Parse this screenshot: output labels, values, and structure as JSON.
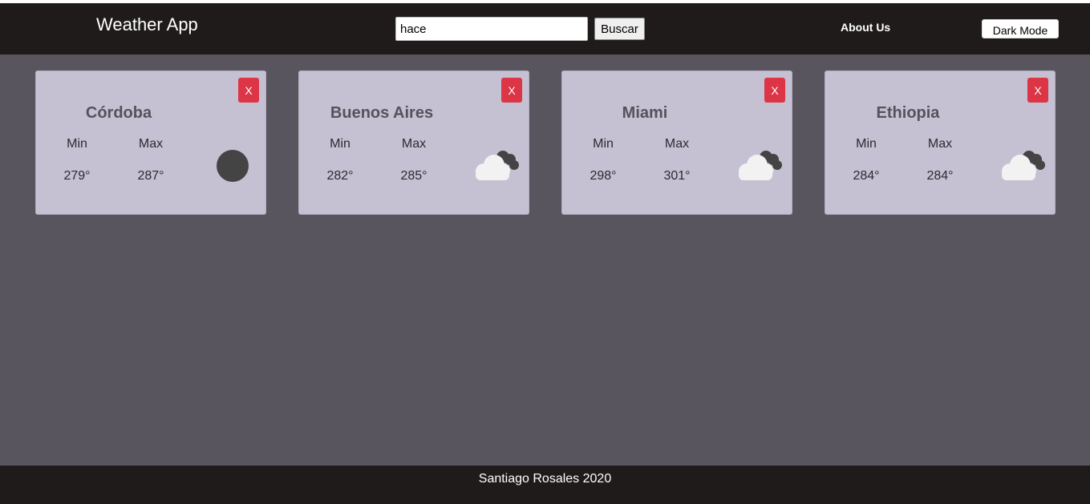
{
  "header": {
    "title": "Weather App",
    "search_value": "hace",
    "search_button": "Buscar",
    "about_link": "About Us",
    "dark_mode_button": "Dark Mode"
  },
  "cards": [
    {
      "city": "Córdoba",
      "min_label": "Min",
      "max_label": "Max",
      "min": "279°",
      "max": "287°",
      "close": "X",
      "icon": "clear-night-icon"
    },
    {
      "city": "Buenos Aires",
      "min_label": "Min",
      "max_label": "Max",
      "min": "282°",
      "max": "285°",
      "close": "X",
      "icon": "cloudy-icon"
    },
    {
      "city": "Miami",
      "min_label": "Min",
      "max_label": "Max",
      "min": "298°",
      "max": "301°",
      "close": "X",
      "icon": "cloudy-icon"
    },
    {
      "city": "Ethiopia",
      "min_label": "Min",
      "max_label": "Max",
      "min": "284°",
      "max": "284°",
      "close": "X",
      "icon": "cloudy-icon"
    }
  ],
  "footer": {
    "text": "Santiago Rosales 2020"
  },
  "colors": {
    "navbar": "#1f1b1b",
    "background": "#58555f",
    "card": "#c5c0d2",
    "close_button": "#dc3545"
  }
}
